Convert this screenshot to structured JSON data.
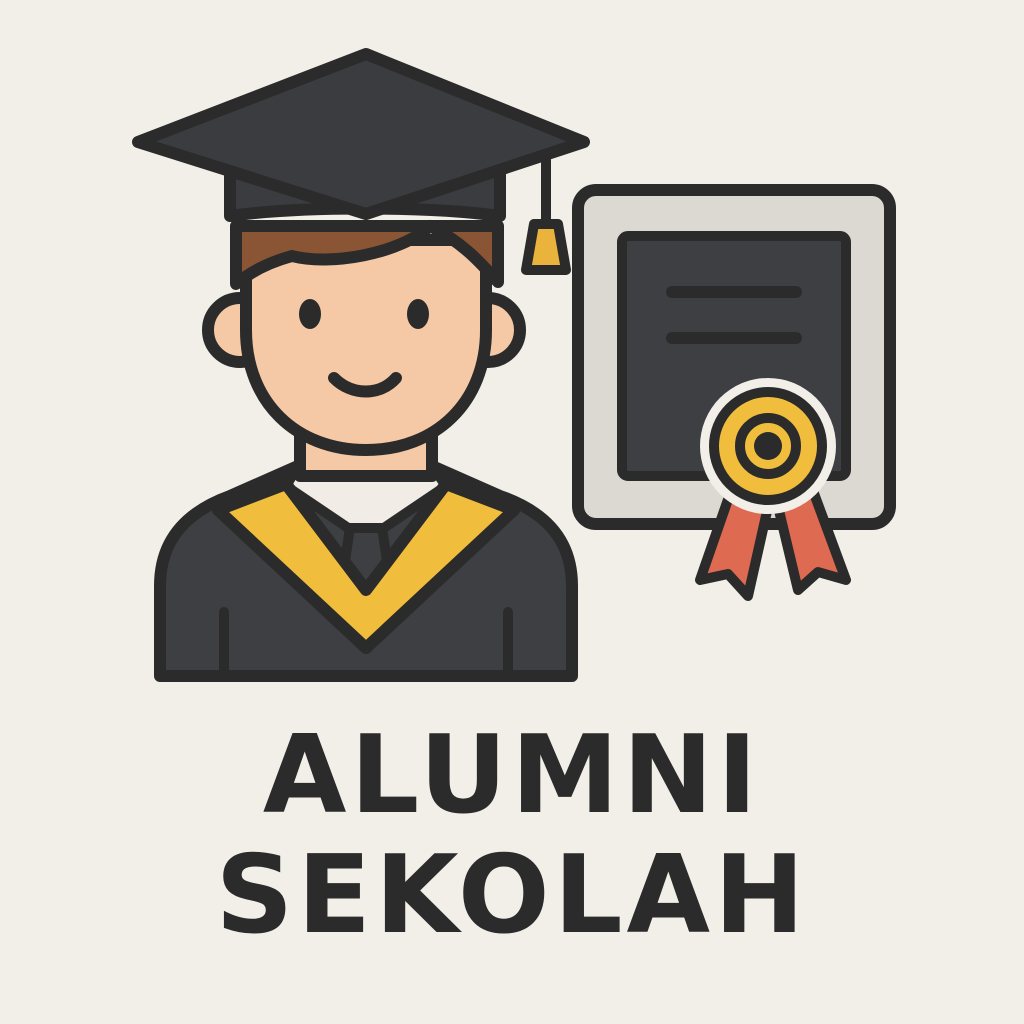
{
  "caption": {
    "line1": "ALUMNI",
    "line2": "SEKOLAH"
  },
  "colors": {
    "background": "#f2efe9",
    "outline": "#2b2b2b",
    "gown": "#3d3f42",
    "cap": "#3a3c40",
    "sash": "#f0bd3c",
    "skin": "#f6c9a6",
    "hair": "#8a5534",
    "collar": "#f1ede6",
    "frame": "#dcd9d3",
    "certificate": "#3d3f42",
    "seal_outer": "#f0bd3c",
    "ribbon": "#de6a52",
    "tassel": "#e9b33c",
    "text": "#2b2b2b"
  },
  "icons": {
    "graduate": "graduate-student-icon",
    "cap": "graduation-cap-icon",
    "certificate": "framed-certificate-icon",
    "seal": "award-seal-icon"
  }
}
